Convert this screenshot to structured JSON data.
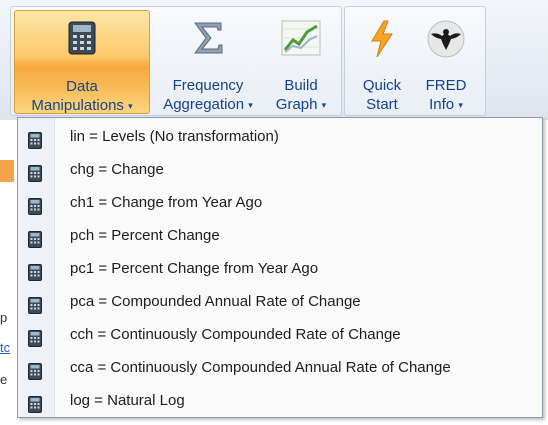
{
  "ribbon": {
    "buttons": [
      {
        "line1": "Data",
        "line2": "Manipulations",
        "caret": "▾",
        "icon": "calculator-icon",
        "active": true
      },
      {
        "line1": "Frequency",
        "line2": "Aggregation",
        "caret": "▾",
        "icon": "sigma-icon"
      },
      {
        "line1": "Build",
        "line2": "Graph",
        "caret": "▾",
        "icon": "line-graph-icon"
      },
      {
        "line1": "Quick",
        "line2": "Start",
        "caret": "",
        "icon": "lightning-icon"
      },
      {
        "line1": "FRED",
        "line2": "Info",
        "caret": "▾",
        "icon": "eagle-icon"
      }
    ]
  },
  "background_fragments": [
    "p",
    "tc",
    "e"
  ],
  "menu": {
    "items": [
      {
        "label": "lin  = Levels (No transformation)"
      },
      {
        "label": "chg = Change"
      },
      {
        "label": "ch1 = Change from Year Ago"
      },
      {
        "label": "pch = Percent Change"
      },
      {
        "label": "pc1 = Percent Change from Year Ago"
      },
      {
        "label": "pca = Compounded Annual Rate of Change"
      },
      {
        "label": "cch = Continuously Compounded Rate of Change"
      },
      {
        "label": "cca = Continuously Compounded Annual Rate of Change"
      },
      {
        "label": "log = Natural Log"
      }
    ]
  },
  "colors": {
    "active_button": "#f9b84e",
    "ribbon_text": "#15428b"
  }
}
